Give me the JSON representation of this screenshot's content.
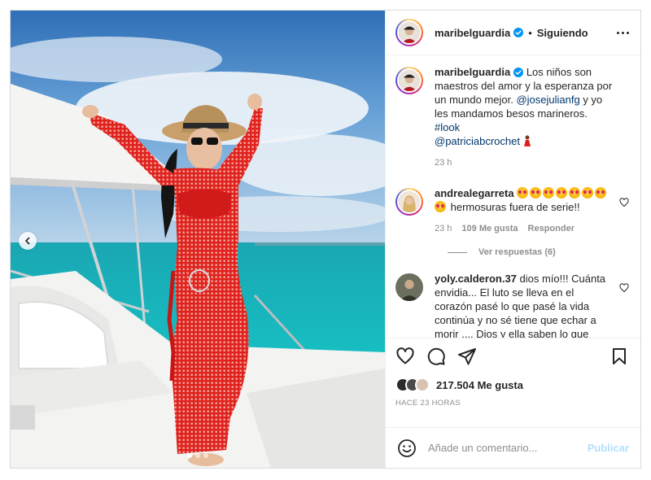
{
  "post": {
    "username": "maribelguardia",
    "follow_separator": "•",
    "follow_state": "Siguiendo",
    "caption": {
      "username": "maribelguardia",
      "text_1": " Los niños son maestros del amor y la esperanza por un mundo mejor. ",
      "mention_1": "@josejulianfg",
      "text_2": " y yo les mandamos besos marineros. ",
      "hashtag": "#look",
      "mention_2": "@patriciabcrochet",
      "time": "23 h"
    },
    "comments": [
      {
        "username": "andrealegarreta",
        "emoji_count": 8,
        "text": " hermosuras fuera de serie!!",
        "time": "23 h",
        "likes": "109 Me gusta",
        "reply": "Responder",
        "view_replies": "Ver respuestas (6)"
      },
      {
        "username": "yoly.calderon.37",
        "text": " dios mío!!! Cuánta envidia... El luto se lleva en el corazón pasé lo que pasé la vida continúa y no sé tiene que echar a morir .... Dios y ella saben lo que sienten en su corazón ❤️ y los demás"
      }
    ],
    "likes_count": "217.504 Me gusta",
    "posted_ago": "HACE 23 HORAS",
    "comment_input": {
      "placeholder": "Añade un comentario...",
      "value": ""
    },
    "publish_label": "Publicar"
  },
  "icons": {
    "more": "more-options-icon",
    "like": "heart-icon",
    "comment": "comment-icon",
    "share": "share-icon",
    "save": "bookmark-icon",
    "emoji": "emoji-icon",
    "prev": "chevron-left-icon",
    "verified": "verified-badge-icon"
  },
  "colors": {
    "verified": "#0095f6",
    "link": "#00376b",
    "muted": "#8e8e8e",
    "publish_disabled": "#b2dffc"
  },
  "carousel": {
    "total": 3,
    "active": 0
  }
}
